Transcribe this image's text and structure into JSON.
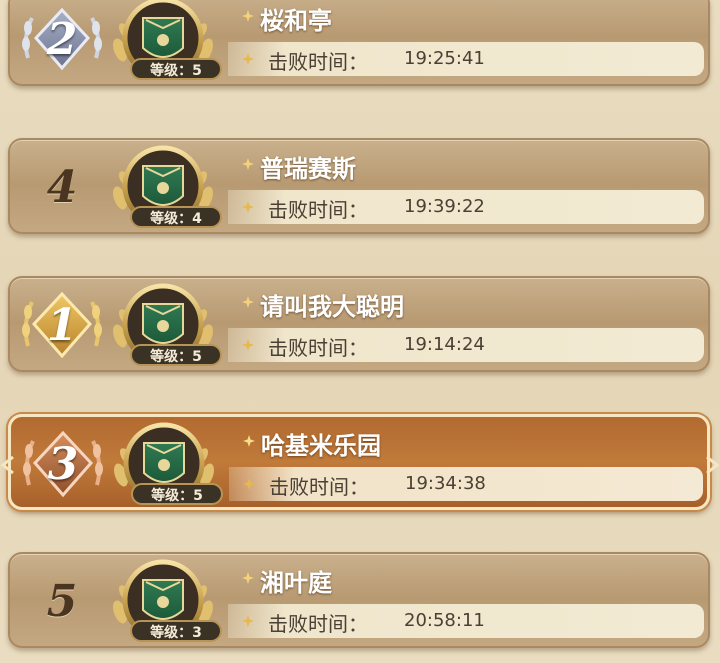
{
  "colors": {
    "rank1": "#d9a84a",
    "rank2": "#8f98b3",
    "rank3": "#b8724a",
    "selected_row": "#b8703a",
    "level_pill": "#3b3226"
  },
  "rows": [
    {
      "rank": "2",
      "level_text": "等级：5",
      "name": "桜和亭",
      "time_label": "击败时间：",
      "time": "19:25:41",
      "badge": "silver"
    },
    {
      "rank": "4",
      "level_text": "等级：4",
      "name": "普瑞赛斯",
      "time_label": "击败时间：",
      "time": "19:39:22",
      "badge": "none"
    },
    {
      "rank": "1",
      "level_text": "等级：5",
      "name": "请叫我大聪明",
      "time_label": "击败时间：",
      "time": "19:14:24",
      "badge": "gold"
    },
    {
      "rank": "3",
      "level_text": "等级：5",
      "name": "哈基米乐园",
      "time_label": "击败时间：",
      "time": "19:34:38",
      "badge": "bronze",
      "selected": true
    },
    {
      "rank": "5",
      "level_text": "等级：3",
      "name": "湘叶庭",
      "time_label": "击败时间：",
      "time": "20:58:11",
      "badge": "none"
    }
  ],
  "icons": {
    "emblem": "guild-shield-icon",
    "sparkle": "sparkle-icon",
    "laurel": "laurel-wreath-icon"
  }
}
